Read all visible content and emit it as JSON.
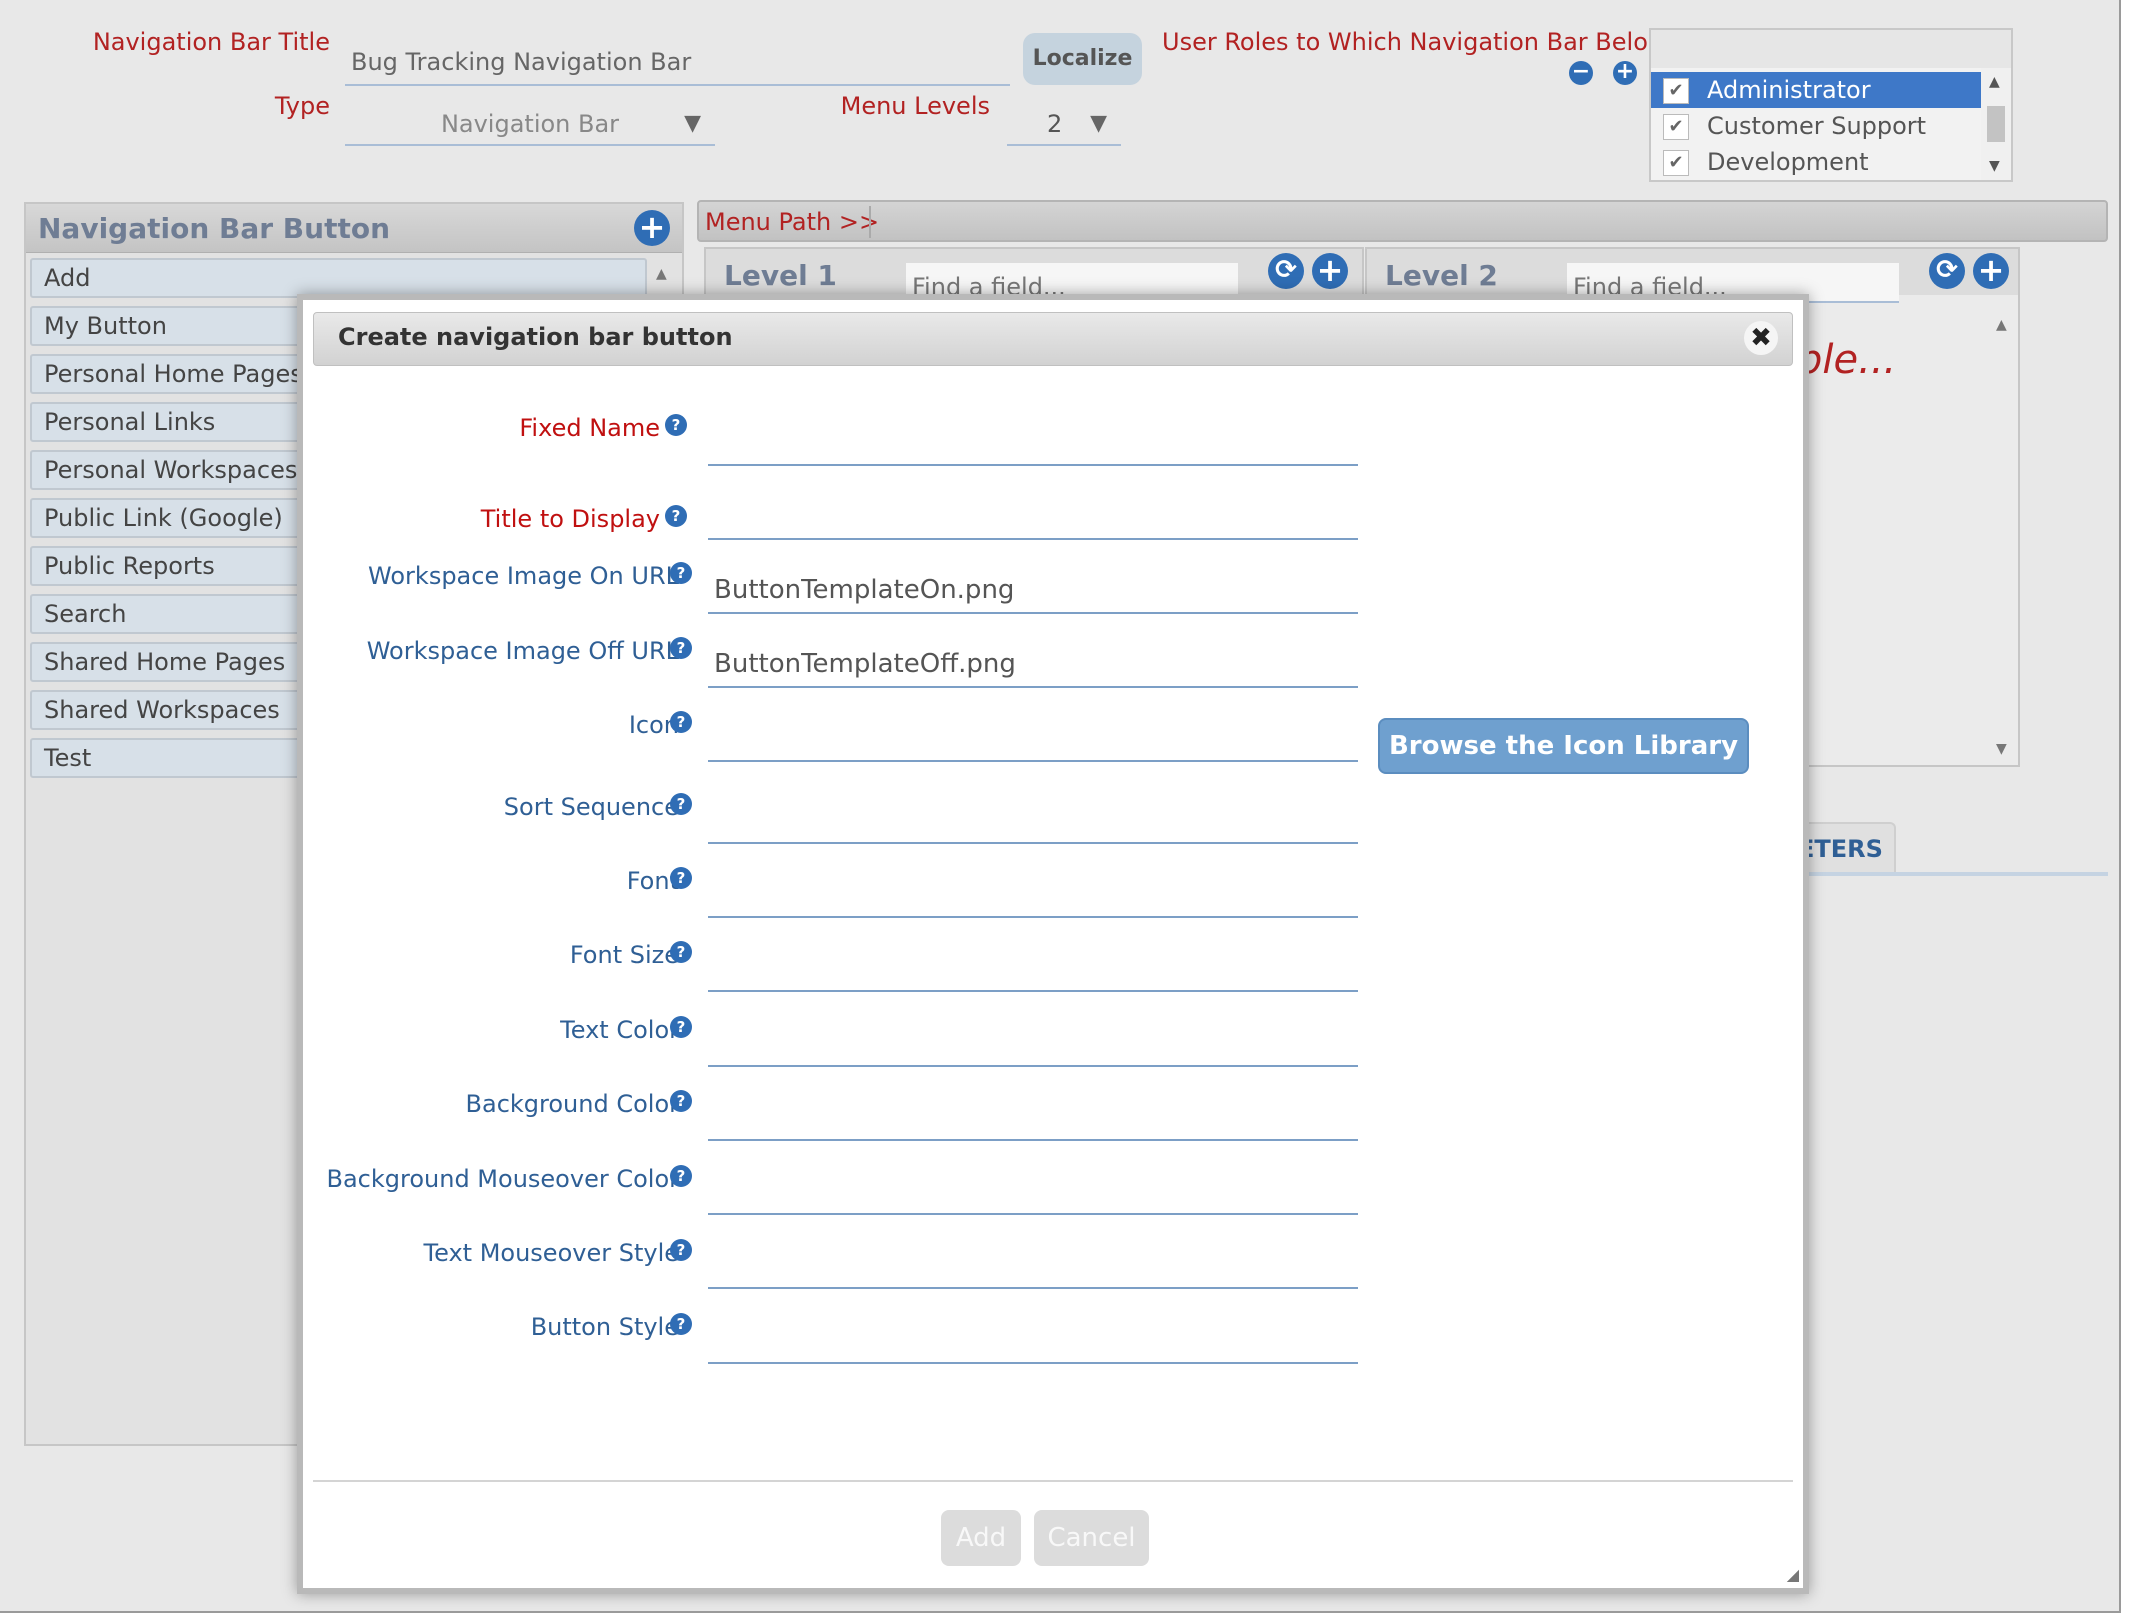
{
  "header": {
    "nav_title_label": "Navigation Bar Title",
    "nav_title_value": "Bug Tracking Navigation Bar",
    "localize_label": "Localize",
    "type_label": "Type",
    "type_value": "Navigation Bar",
    "menu_levels_label": "Menu Levels",
    "menu_levels_value": "2",
    "roles_label": "User Roles to Which Navigation Bar Belongs",
    "roles": [
      {
        "label": "Administrator",
        "checked": true,
        "selected": true
      },
      {
        "label": "Customer Support",
        "checked": true,
        "selected": false
      },
      {
        "label": "Development Engineer",
        "checked": true,
        "selected": false
      }
    ]
  },
  "left_panel": {
    "title": "Navigation Bar Button",
    "items": [
      "Add",
      "My Button",
      "Personal Home Pages",
      "Personal Links",
      "Personal Workspaces",
      "Public Link (Google)",
      "Public Reports",
      "Search",
      "Shared Home Pages",
      "Shared Workspaces",
      "Test"
    ]
  },
  "menu_path": {
    "label": "Menu Path >>"
  },
  "levels": [
    {
      "title": "Level 1",
      "find_placeholder": "Find a field..."
    },
    {
      "title": "Level 2",
      "find_placeholder": "Find a field...",
      "hint_fragment": "ble..."
    }
  ],
  "tab_fragment": "ETERS",
  "modal": {
    "title": "Create navigation bar button",
    "close_glyph": "✖",
    "fields": [
      {
        "label": "Fixed Name",
        "value": "",
        "required": true
      },
      {
        "label": "Title to Display",
        "value": "",
        "required": true
      },
      {
        "label": "Workspace Image On URL",
        "value": "ButtonTemplateOn.png",
        "required": false
      },
      {
        "label": "Workspace Image Off URL",
        "value": "ButtonTemplateOff.png",
        "required": false
      },
      {
        "label": "Icon",
        "value": "",
        "required": false
      },
      {
        "label": "Sort Sequence",
        "value": "",
        "required": false
      },
      {
        "label": "Font",
        "value": "",
        "required": false
      },
      {
        "label": "Font Size",
        "value": "",
        "required": false
      },
      {
        "label": "Text Color",
        "value": "",
        "required": false
      },
      {
        "label": "Background Color",
        "value": "",
        "required": false
      },
      {
        "label": "Background Mouseover Color",
        "value": "",
        "required": false
      },
      {
        "label": "Text Mouseover Style",
        "value": "",
        "required": false
      },
      {
        "label": "Button Style",
        "value": "",
        "required": false
      }
    ],
    "browse_label": "Browse the Icon Library",
    "add_label": "Add",
    "cancel_label": "Cancel"
  },
  "colors": {
    "required_label": "#c01010",
    "field_label": "#2f5f95",
    "accent": "#2f6db5",
    "selected_row": "#3e78c8"
  },
  "icons": [
    "plus-circle-icon",
    "minus-circle-icon",
    "refresh-icon",
    "help-icon",
    "close-icon",
    "dropdown-arrow-icon",
    "checkbox-icon",
    "resize-grip-icon"
  ]
}
